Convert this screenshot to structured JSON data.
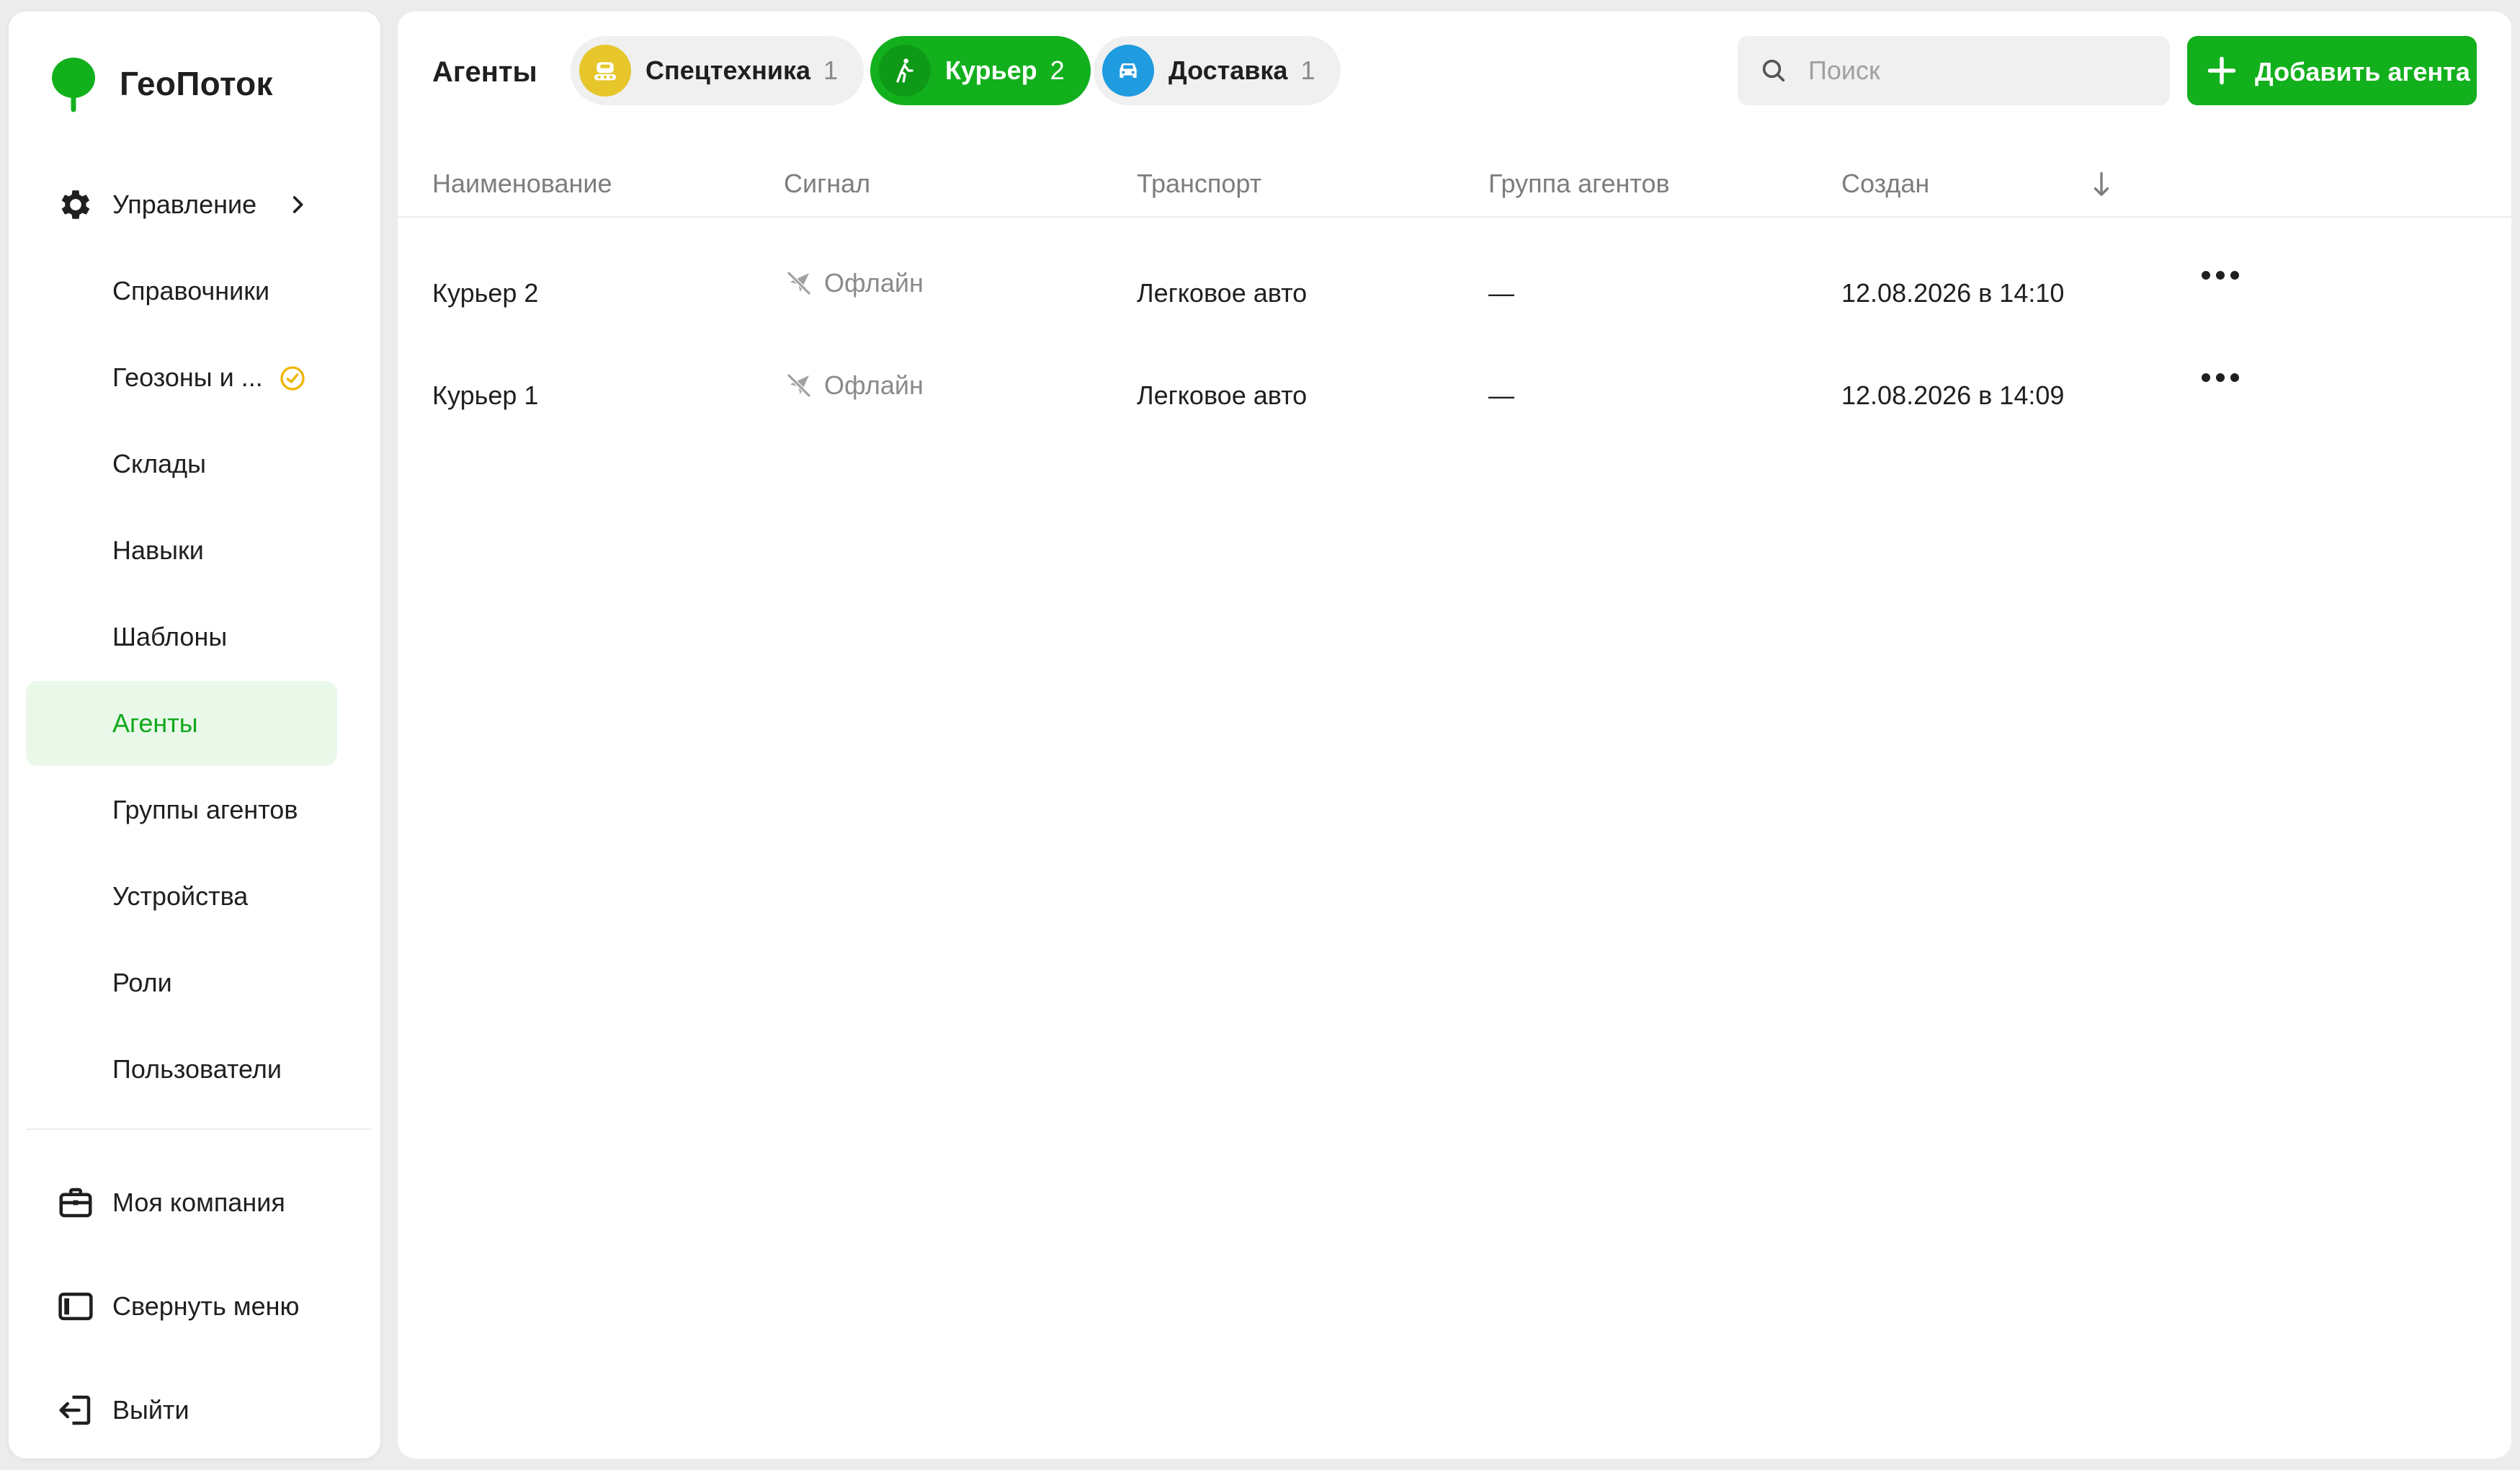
{
  "colors": {
    "brand": "#12b01c",
    "active_bg": "#e9f8e9",
    "spec_icon_bg": "#e7c62b",
    "delivery_icon_bg": "#1f9be0",
    "warning": "#f0b400"
  },
  "brand": {
    "name": "ГеоПоток",
    "logo_icon": "leaf-pin-icon"
  },
  "sidebar": {
    "management": {
      "label": "Управление",
      "icon": "gear-icon",
      "chevron": "chevron-right-icon"
    },
    "items": [
      {
        "label": "Справочники"
      },
      {
        "label": "Геозоны и ...",
        "icon": "clock-warning-icon"
      },
      {
        "label": "Склады"
      },
      {
        "label": "Навыки"
      },
      {
        "label": "Шаблоны"
      },
      {
        "label": "Агенты",
        "active": true
      },
      {
        "label": "Группы агентов"
      },
      {
        "label": "Устройства"
      },
      {
        "label": "Роли"
      },
      {
        "label": "Пользователи"
      }
    ],
    "bottom": [
      {
        "label": "Моя компания",
        "icon": "briefcase-icon"
      },
      {
        "label": "Свернуть меню",
        "icon": "collapse-panel-icon"
      },
      {
        "label": "Выйти",
        "icon": "logout-icon"
      }
    ]
  },
  "header": {
    "title": "Агенты",
    "filters": [
      {
        "label": "Спецтехника",
        "count": "1",
        "icon": "tractor-icon",
        "active": false
      },
      {
        "label": "Курьер",
        "count": "2",
        "icon": "walking-person-icon",
        "active": true
      },
      {
        "label": "Доставка",
        "count": "1",
        "icon": "car-icon",
        "active": false
      }
    ],
    "search": {
      "placeholder": "Поиск",
      "value": "",
      "icon": "search-icon"
    },
    "add_button": {
      "label": "Добавить агента",
      "icon": "plus-icon"
    }
  },
  "table": {
    "columns": [
      "Наименование",
      "Сигнал",
      "Транспорт",
      "Группа агентов",
      "Создан"
    ],
    "sort_icon": "arrow-down-icon",
    "rows": [
      {
        "name": "Курьер 2",
        "signal": "Офлайн",
        "transport": "Легковое авто",
        "group": "—",
        "created": "12.08.2026 в 14:10"
      },
      {
        "name": "Курьер 1",
        "signal": "Офлайн",
        "transport": "Легковое авто",
        "group": "—",
        "created": "12.08.2026 в 14:09"
      }
    ]
  }
}
